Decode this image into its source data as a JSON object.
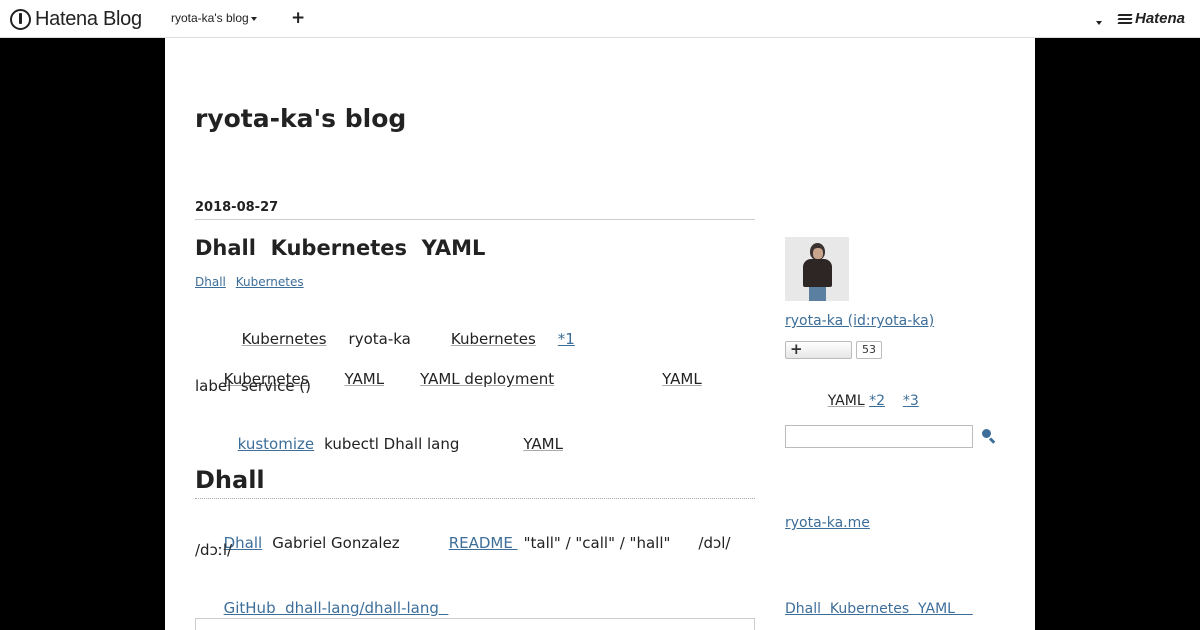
{
  "topbar": {
    "logo_text": "Hatena Blog",
    "blog_name": "ryota-ka's blog",
    "add_label": "+",
    "brand": "Hatena"
  },
  "blog": {
    "title": "ryota-ka's blog"
  },
  "entry": {
    "date": "2018-08-27",
    "title": "Dhall  Kubernetes  YAML",
    "categories": [
      "Dhall",
      "Kubernetes"
    ],
    "p1": {
      "a": "Kubernetes",
      "b": "ryota-ka",
      "c": "Kubernetes",
      "footnote": "*1"
    },
    "p2": {
      "a": "Kubernetes",
      "b": "YAML",
      "c": "YAML deployment",
      "d": "YAML",
      "e": "label  service ()"
    },
    "p3": {
      "link": "kustomize",
      "text": "kubectl Dhall lang",
      "yaml": "YAML"
    },
    "section_heading": "Dhall",
    "p4": {
      "link": "Dhall",
      "author": "Gabriel Gonzalez",
      "readme": "README ",
      "pron": "\"tall\" / \"call\" / \"hall\"",
      "ipa1": "/dɔl/",
      "ipa2": "/dɔːl/"
    },
    "github_link": "GitHub  dhall-lang/dhall-lang  "
  },
  "sidebar": {
    "profile_name": "ryota-ka (id:ryota-ka)",
    "follow_label": "+",
    "follow_count": "53",
    "note": {
      "text": "YAML",
      "fn2": "*2",
      "fn3": "*3"
    },
    "search_placeholder": "",
    "site_link": "ryota-ka.me",
    "recent_link": "Dhall  Kubernetes  YAML    "
  },
  "colors": {
    "link": "#3d6e99",
    "background": "#000000",
    "content": "#ffffff"
  }
}
